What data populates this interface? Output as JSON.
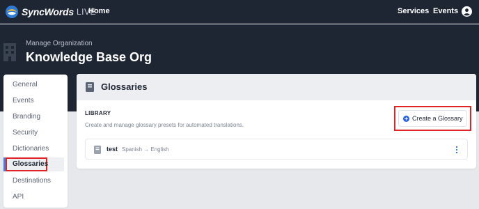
{
  "nav": {
    "logo_word": "SyncWords",
    "logo_live": "LIVE",
    "home": "Home",
    "services": "Services",
    "events": "Events"
  },
  "header": {
    "manage_label": "Manage Organization",
    "org_name": "Knowledge Base Org"
  },
  "sidebar": {
    "items": [
      {
        "label": "General"
      },
      {
        "label": "Events"
      },
      {
        "label": "Branding"
      },
      {
        "label": "Security"
      },
      {
        "label": "Dictionaries"
      },
      {
        "label": "Glossaries",
        "active": true
      },
      {
        "label": "Destinations"
      },
      {
        "label": "API"
      }
    ]
  },
  "main": {
    "title": "Glossaries",
    "library_label": "LIBRARY",
    "library_desc": "Create and manage glossary presets for automated translations.",
    "create_button": "Create a Glossary",
    "glossaries": [
      {
        "name": "test",
        "languages": "Spanish → English"
      }
    ]
  },
  "colors": {
    "navbar": "#1f2633",
    "accent": "#3b82f6",
    "highlight": "#e02424"
  }
}
